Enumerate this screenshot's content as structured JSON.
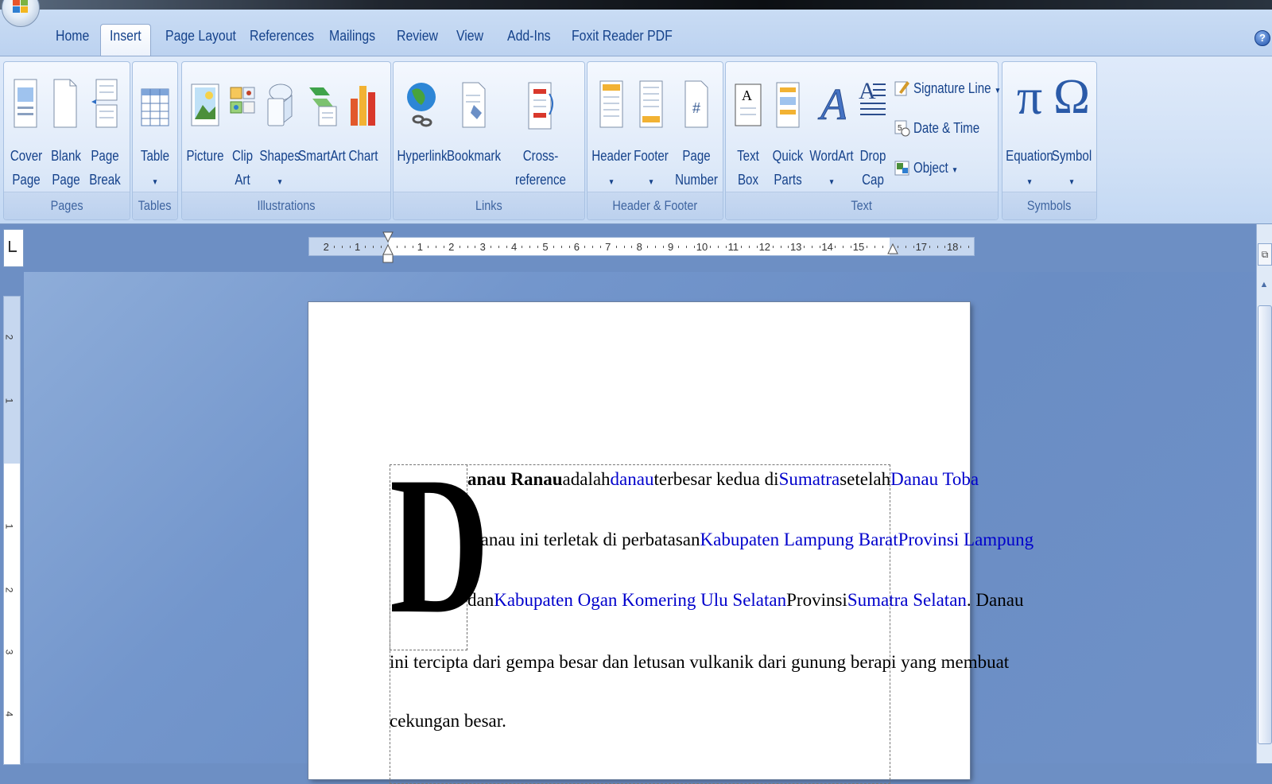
{
  "tabs": [
    "Home",
    "Insert",
    "Page Layout",
    "References",
    "Mailings",
    "Review",
    "View",
    "Add-Ins",
    "Foxit Reader PDF"
  ],
  "active_tab": "Insert",
  "groups": {
    "pages": {
      "label": "Pages",
      "buttons": [
        "Cover\nPage",
        "Blank\nPage",
        "Page\nBreak"
      ]
    },
    "tables": {
      "label": "Tables",
      "buttons": [
        "Table"
      ]
    },
    "illustrations": {
      "label": "Illustrations",
      "buttons": [
        "Picture",
        "Clip\nArt",
        "Shapes",
        "SmartArt",
        "Chart"
      ]
    },
    "links": {
      "label": "Links",
      "buttons": [
        "Hyperlink",
        "Bookmark",
        "Cross-reference"
      ]
    },
    "header_footer": {
      "label": "Header & Footer",
      "buttons": [
        "Header",
        "Footer",
        "Page\nNumber"
      ]
    },
    "text": {
      "label": "Text",
      "buttons": [
        "Text\nBox",
        "Quick\nParts",
        "WordArt",
        "Drop\nCap"
      ],
      "small": [
        "Signature Line",
        "Date & Time",
        "Object"
      ]
    },
    "symbols": {
      "label": "Symbols",
      "buttons": [
        "Equation",
        "Symbol"
      ]
    }
  },
  "ruler": {
    "ticks": [
      "2",
      "1",
      "1",
      "2",
      "3",
      "4",
      "5",
      "6",
      "7",
      "8",
      "9",
      "10",
      "11",
      "12",
      "13",
      "14",
      "15",
      "17",
      "18"
    ]
  },
  "vruler": {
    "ticks": [
      "2",
      "1",
      "1",
      "2",
      "3",
      "4"
    ]
  },
  "document": {
    "dropcap": "D",
    "line1": {
      "bold": "anau Ranau",
      "t1": "adalah",
      "l1": "danau",
      "t2": "terbesar kedua di",
      "l2": "Sumatra",
      "t3": "setelah",
      "l3": "Danau Toba"
    },
    "line2": {
      "t1": "Danau ini terletak di perbatasan",
      "l1": "Kabupaten Lampung Barat",
      "l2": "Provinsi Lampung"
    },
    "line3": {
      "t1": "dan",
      "l1": "Kabupaten Ogan Komering Ulu Selatan",
      "t2": "Provinsi",
      "l2": "Sumatra Selatan",
      "t3": ". Danau"
    },
    "line4": "ini tercipta dari gempa besar dan letusan vulkanik dari gunung berapi yang membuat",
    "line5": "cekungan besar."
  },
  "colors": {
    "link": "#0000cc",
    "ribbon_text": "#15428b",
    "group_label": "#3e64a0"
  }
}
